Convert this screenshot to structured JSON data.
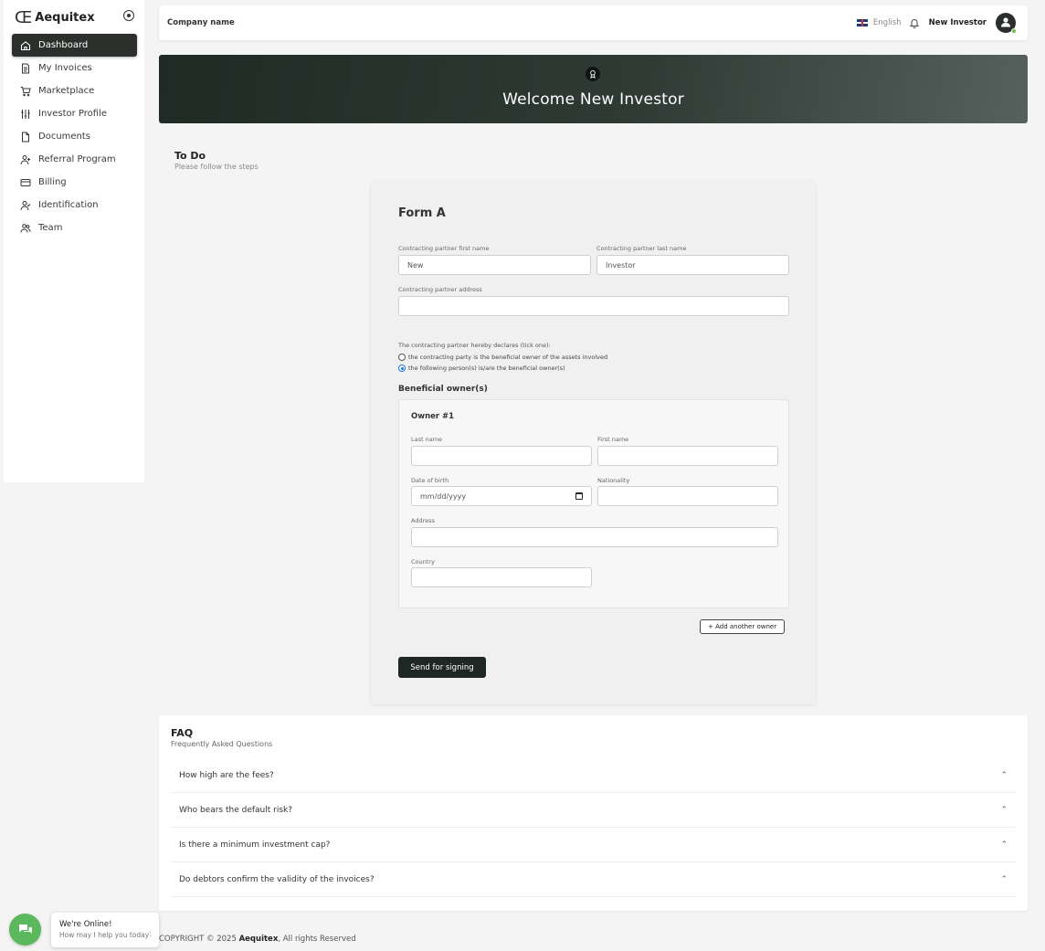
{
  "brand": {
    "mark": "Œ",
    "name": "Aequitex"
  },
  "sidebar": {
    "items": [
      {
        "label": "Dashboard",
        "icon": "home-icon",
        "active": true
      },
      {
        "label": "My Invoices",
        "icon": "invoice-icon"
      },
      {
        "label": "Marketplace",
        "icon": "cart-icon"
      },
      {
        "label": "Investor Profile",
        "icon": "sliders-icon"
      },
      {
        "label": "Documents",
        "icon": "document-icon"
      },
      {
        "label": "Referral Program",
        "icon": "user-plus-icon"
      },
      {
        "label": "Billing",
        "icon": "card-icon"
      },
      {
        "label": "Identification",
        "icon": "user-check-icon"
      },
      {
        "label": "Team",
        "icon": "users-icon"
      }
    ]
  },
  "header": {
    "company": "Company name",
    "language": "English",
    "user": "New Investor"
  },
  "hero": {
    "title": "Welcome New Investor",
    "icon": "award-icon"
  },
  "todo": {
    "title": "To Do",
    "subtitle": "Please follow the steps"
  },
  "form": {
    "title": "Form A",
    "first_name_label": "Contracting partner first name",
    "first_name_value": "New",
    "last_name_label": "Contracting partner last name",
    "last_name_value": "Investor",
    "address_label": "Contracting partner address",
    "address_value": "",
    "declare_label": "The contracting partner hereby declares (tick one):",
    "option_1": "the contracting party is the beneficial owner of the assets involved",
    "option_2": "the following person(s) is/are the beneficial owner(s)",
    "selected_option": 2,
    "beneficial_title": "Beneficial owner(s)",
    "owner": {
      "title": "Owner #1",
      "last_name_label": "Last name",
      "first_name_label": "First name",
      "dob_label": "Date of birth",
      "dob_placeholder": "mm/dd/yyyy",
      "nationality_label": "Nationality",
      "address_label": "Address",
      "country_label": "Country"
    },
    "add_owner": "+ Add another owner",
    "send": "Send for signing"
  },
  "faq": {
    "title": "FAQ",
    "subtitle": "Frequently Asked Questions",
    "items": [
      "How high are the fees?",
      "Who bears the default risk?",
      "Is there a minimum investment cap?",
      "Do debtors confirm the validity of the invoices?"
    ]
  },
  "footer": {
    "prefix": "COPYRIGHT © 2025",
    "brand": "Aequitex",
    "suffix": ", All rights Reserved"
  },
  "chat": {
    "title": "We're Online!",
    "subtitle": "How may I help you today?"
  },
  "colors": {
    "sidebar_active": "#2b302d",
    "primary_button": "#1f2724",
    "chat": "#5cb85c",
    "online": "#6fbf4a"
  }
}
